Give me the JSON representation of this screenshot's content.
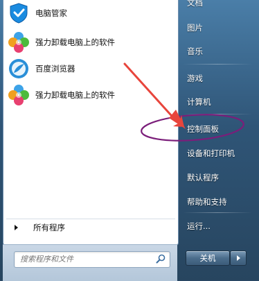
{
  "programs": [
    {
      "label": "电脑管家",
      "icon": "tencent-pc-manager-icon"
    },
    {
      "label": "强力卸载电脑上的软件",
      "icon": "uninstaller-icon"
    },
    {
      "label": "百度浏览器",
      "icon": "baidu-browser-icon"
    },
    {
      "label": "强力卸载电脑上的软件",
      "icon": "uninstaller-icon"
    }
  ],
  "all_programs_label": "所有程序",
  "search": {
    "placeholder": "搜索程序和文件"
  },
  "right_items": [
    {
      "label": "文档"
    },
    {
      "label": "图片"
    },
    {
      "label": "音乐"
    },
    {
      "label": "游戏"
    },
    {
      "label": "计算机"
    },
    {
      "label": "控制面板"
    },
    {
      "label": "设备和打印机"
    },
    {
      "label": "默认程序"
    },
    {
      "label": "帮助和支持"
    },
    {
      "label": "运行..."
    }
  ],
  "shutdown_label": "关机",
  "colors": {
    "annotation_arrow": "#e8453c",
    "annotation_ellipse": "#7b1e7a"
  }
}
